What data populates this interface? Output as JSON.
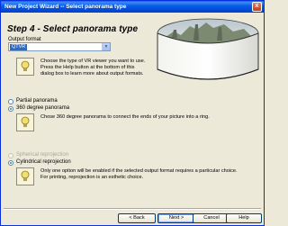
{
  "window": {
    "title": "New Project Wizard -- Select panorama type",
    "close_glyph": "x"
  },
  "step": {
    "title": "Step 4 - Select panorama type"
  },
  "output_format": {
    "label": "Output format",
    "selected": "QTVR",
    "dropdown_arrow_icon": "chevron-down-icon",
    "help_text_1": "Choose the type of VR viewer you want to use.",
    "help_text_2": "Press the Help button at the bottom of this",
    "help_text_3": "dialog box to learn more about output formats."
  },
  "panorama_type": {
    "partial_label": "Partial panorama",
    "degree_label": "360 degree panorama",
    "selected": "360 degree panorama",
    "help_text": "Chose 360 degree panorama to connect the ends of your picture into a ring."
  },
  "projection": {
    "spherical_label": "Spherical reprojection",
    "spherical_enabled": false,
    "cylindrical_label": "Cylindrical reprojection",
    "selected": "Cylindrical reprojection",
    "help_text_1": "Only one option will be enabled if the selected output format requires a particular choice.",
    "help_text_2": "For printing, reprojection is an esthetic choice."
  },
  "buttons": {
    "back": "< Back",
    "next": "Next >",
    "cancel": "Cancel",
    "help": "Help"
  },
  "colors": {
    "titlebar": "#0a5fe8",
    "dialog_bg": "#ece9d8",
    "selection": "#316ac5"
  }
}
